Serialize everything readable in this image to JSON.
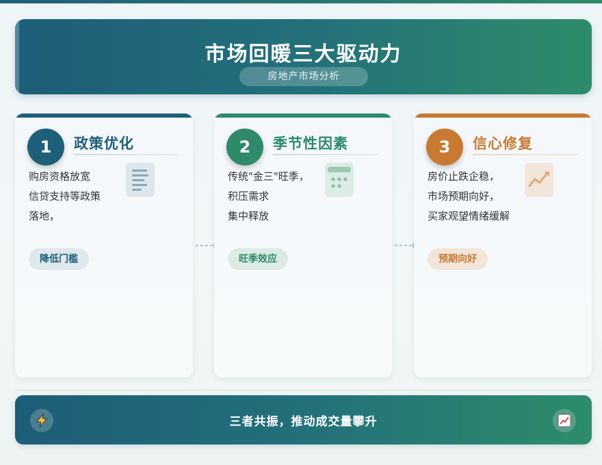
{
  "header": {
    "title": "市场回暖三大驱动力",
    "subtitle": "房地产市场分析"
  },
  "cards": [
    {
      "number": "1",
      "title": "政策优化",
      "lines": [
        "购房资格放宽",
        "信贷支持等政策",
        "落地，"
      ],
      "tag": "降低门槛",
      "icon": "document-icon",
      "color": "#1e5f7a"
    },
    {
      "number": "2",
      "title": "季节性因素",
      "lines": [
        "传统\"金三\"旺季，",
        "积压需求",
        "集中释放"
      ],
      "tag": "旺季效应",
      "icon": "calendar-icon",
      "color": "#2e8a6a"
    },
    {
      "number": "3",
      "title": "信心修复",
      "lines": [
        "房价止跌企稳，",
        "市场预期向好，",
        "买家观望情绪缓解"
      ],
      "tag": "预期向好",
      "icon": "trend-up-icon",
      "color": "#c87a32"
    }
  ],
  "footer": {
    "text": "三者共振，推动成交量攀升",
    "left_icon": "lightning-icon",
    "right_icon": "chart-up-icon"
  }
}
